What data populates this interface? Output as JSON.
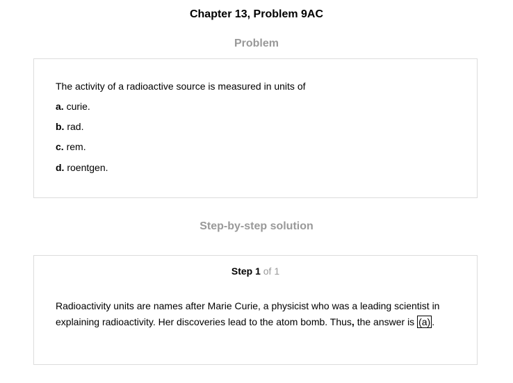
{
  "header": {
    "title": "Chapter 13, Problem 9AC"
  },
  "problem_section": {
    "heading": "Problem",
    "question": "The activity of a radioactive source is measured in units of",
    "choices": [
      {
        "letter": "a.",
        "text": "curie."
      },
      {
        "letter": "b.",
        "text": "rad."
      },
      {
        "letter": "c.",
        "text": "rem."
      },
      {
        "letter": "d.",
        "text": "roentgen."
      }
    ]
  },
  "solution_section": {
    "heading": "Step-by-step solution",
    "step_label": "Step 1",
    "step_of": "of 1",
    "text_part1": "Radioactivity units are names after Marie Curie, a physicist who was a leading scientist in explaining radioactivity. Her discoveries lead to the atom bomb. Thus",
    "comma": ",",
    "text_part2": " the answer is ",
    "answer": "(a)",
    "end_punct": "."
  }
}
